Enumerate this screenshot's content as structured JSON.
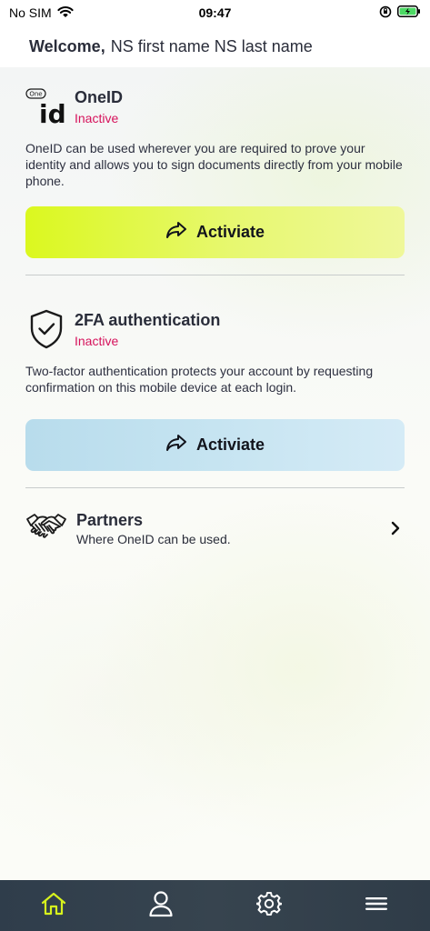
{
  "status_bar": {
    "carrier": "No SIM",
    "time": "09:47"
  },
  "header": {
    "welcome_label": "Welcome,",
    "user_name": "NS first name NS last name"
  },
  "oneid": {
    "logo_small_text": "One",
    "logo_big_text": "id",
    "title": "OneID",
    "status": "Inactive",
    "description": "OneID can be used wherever you are required to prove your identity and allows you to sign documents directly from your mobile phone.",
    "button_label": "Activiate"
  },
  "twofa": {
    "title": "2FA authentication",
    "status": "Inactive",
    "description": "Two-factor authentication protects your account by requesting confirmation on this mobile device at each login.",
    "button_label": "Activiate"
  },
  "partners": {
    "title": "Partners",
    "subtitle": "Where OneID can be used."
  },
  "tab_bar": {
    "tabs": [
      {
        "icon": "home-icon",
        "active": true
      },
      {
        "icon": "user-icon",
        "active": false
      },
      {
        "icon": "gear-icon",
        "active": false
      },
      {
        "icon": "menu-icon",
        "active": false
      }
    ]
  },
  "colors": {
    "status_inactive": "#d6125b",
    "oneid_button": "#dbf81f",
    "twofa_button": "#b8dcec",
    "tab_bar": "#313e4b",
    "tab_active": "#d7f21d"
  }
}
